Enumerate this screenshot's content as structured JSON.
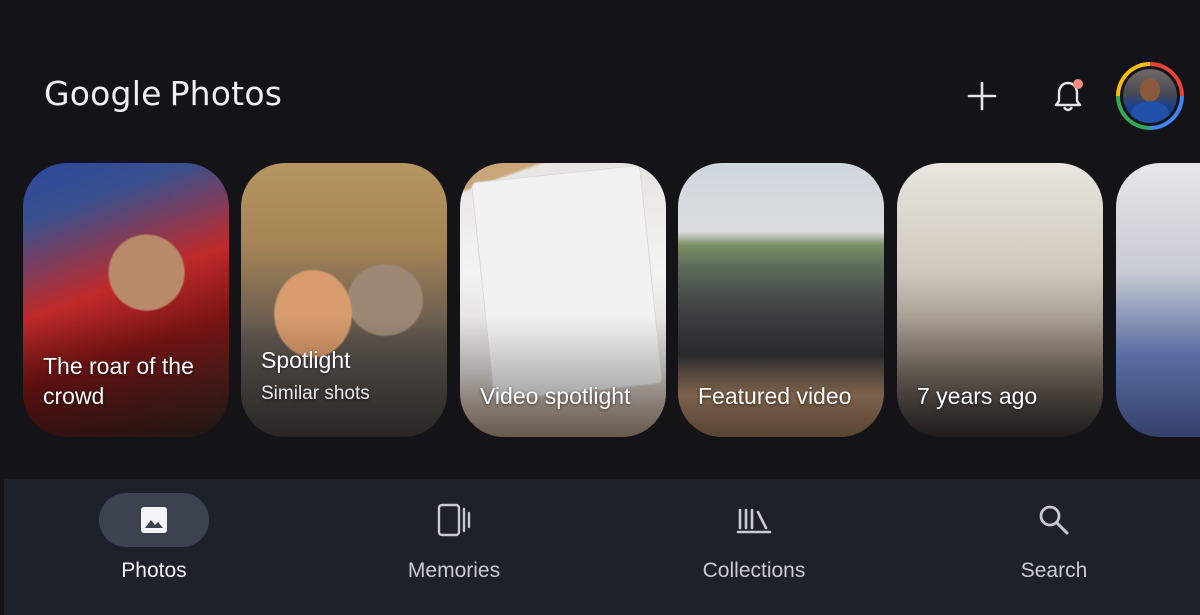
{
  "header": {
    "logo_google": "Google",
    "logo_photos": "Photos",
    "add_icon": "plus-icon",
    "notifications_icon": "bell-icon",
    "notification_dot_color": "#f28b82",
    "avatar_ring_colors": [
      "#ea4335",
      "#4285f4",
      "#34a853",
      "#fbbc05"
    ]
  },
  "memories": [
    {
      "title": "The roar of the crowd"
    },
    {
      "title": "Spotlight",
      "subtitle": "Similar shots"
    },
    {
      "title": "Video spotlight"
    },
    {
      "title": "Featured video"
    },
    {
      "title": "7 years ago"
    },
    {
      "title": ""
    }
  ],
  "bottom_nav": {
    "items": [
      {
        "label": "Photos",
        "icon": "image-icon",
        "active": true
      },
      {
        "label": "Memories",
        "icon": "memories-icon",
        "active": false
      },
      {
        "label": "Collections",
        "icon": "library-icon",
        "active": false
      },
      {
        "label": "Search",
        "icon": "search-icon",
        "active": false
      }
    ]
  },
  "colors": {
    "background": "#131318",
    "nav_background": "#1d2129",
    "active_pill": "#3c4250"
  }
}
